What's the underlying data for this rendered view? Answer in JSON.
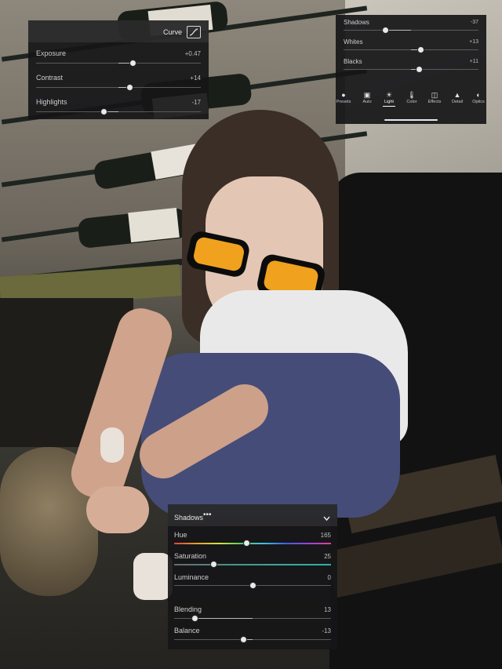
{
  "curve_panel": {
    "curve_label": "Curve",
    "sliders": [
      {
        "label": "Exposure",
        "value": "+0.47",
        "level": 0.59
      },
      {
        "label": "Contrast",
        "value": "+14",
        "level": 0.57
      },
      {
        "label": "Highlights",
        "value": "-17",
        "level": 0.41
      }
    ]
  },
  "light_panel": {
    "sliders": [
      {
        "label": "Shadows",
        "value": "-37",
        "level": 0.31
      },
      {
        "label": "Whites",
        "value": "+13",
        "level": 0.57
      },
      {
        "label": "Blacks",
        "value": "+11",
        "level": 0.56
      }
    ],
    "toolbar": [
      {
        "label": "Presets",
        "icon": "presets-icon"
      },
      {
        "label": "Auto",
        "icon": "auto-icon"
      },
      {
        "label": "Light",
        "icon": "light-icon"
      },
      {
        "label": "Color",
        "icon": "color-icon"
      },
      {
        "label": "Effects",
        "icon": "effects-icon"
      },
      {
        "label": "Detail",
        "icon": "detail-icon"
      },
      {
        "label": "Optics",
        "icon": "optics-icon"
      }
    ],
    "active_tab": "Light"
  },
  "grading_panel": {
    "title": "Shadows",
    "sliders": [
      {
        "label": "Hue",
        "value": "165",
        "level": 0.46
      },
      {
        "label": "Saturation",
        "value": "25",
        "level": 0.25
      },
      {
        "label": "Luminance",
        "value": "0",
        "level": 0.5
      },
      {
        "label": "Blending",
        "value": "13",
        "level": 0.13
      },
      {
        "label": "Balance",
        "value": "-13",
        "level": 0.44
      }
    ]
  }
}
